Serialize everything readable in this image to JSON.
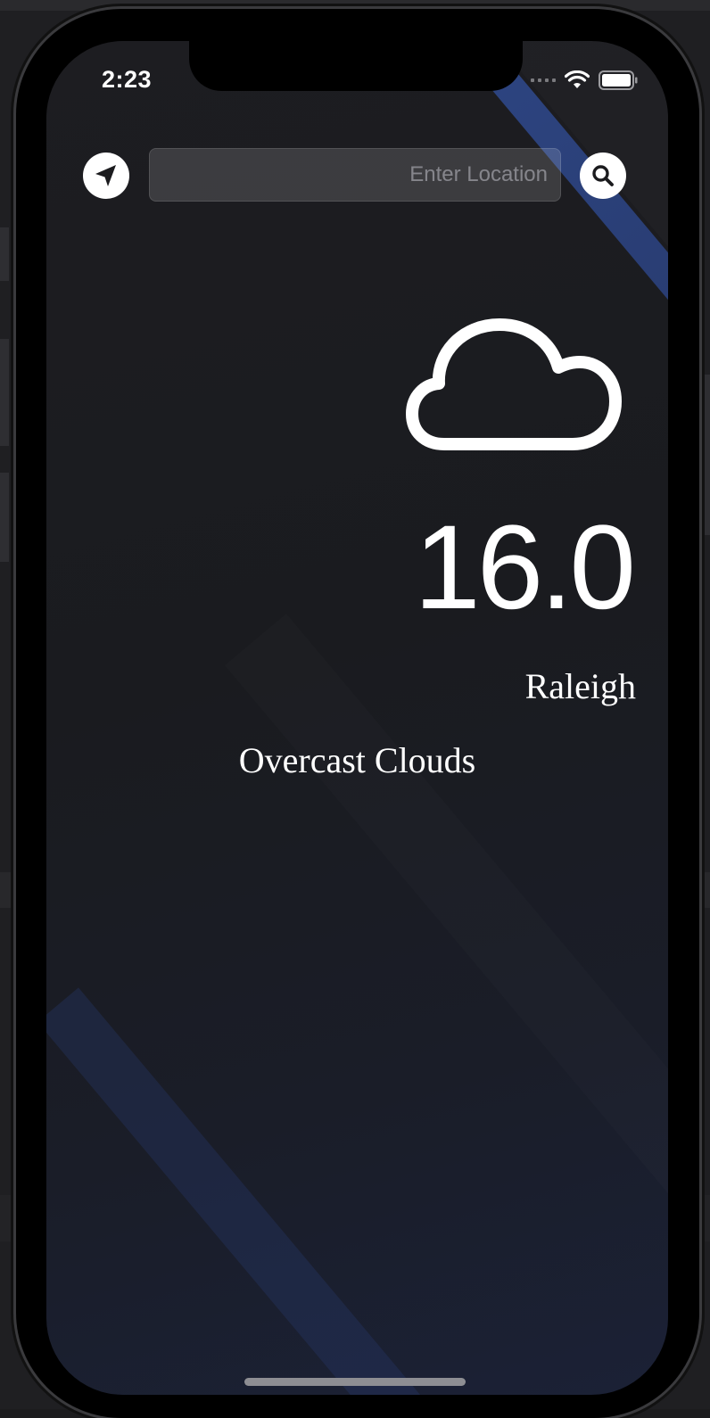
{
  "status_bar": {
    "time": "2:23",
    "icons": [
      "signal-dots-icon",
      "wifi-icon",
      "battery-icon"
    ]
  },
  "search": {
    "placeholder": "Enter Location",
    "value": ""
  },
  "buttons": {
    "location_icon": "location-arrow-icon",
    "search_icon": "magnifier-icon"
  },
  "weather": {
    "icon": "cloud-icon",
    "temperature": "16.0",
    "city": "Raleigh",
    "condition": "Overcast Clouds"
  },
  "colors": {
    "text": "#ffffff",
    "accent_stripe": "#2c3f73",
    "background_top": "#1d1d21",
    "background_bottom": "#1b2136"
  }
}
